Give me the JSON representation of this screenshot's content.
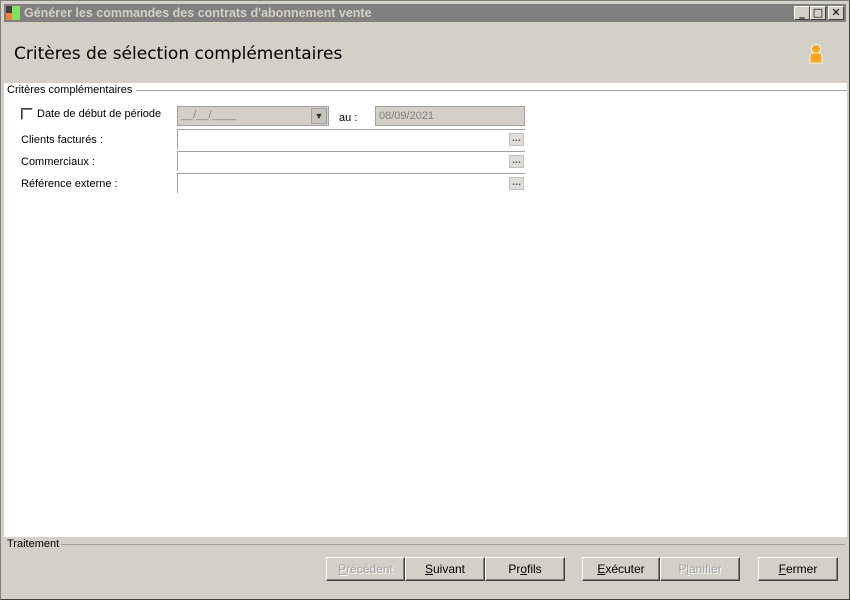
{
  "window": {
    "title": "Générer les commandes des contrats d'abonnement vente",
    "minimize": "_",
    "maximize": "□",
    "close": "✕"
  },
  "header": {
    "title": "Critères de sélection complémentaires",
    "icon": "user-icon"
  },
  "group": {
    "legend": "Critères complémentaires"
  },
  "form": {
    "date_label": "Date de début de période",
    "date_from": "__/__/____",
    "au_label": "au :",
    "date_to": "08/09/2021",
    "clients_label": "Clients facturés :",
    "commerciaux_label": "Commerciaux :",
    "reference_label": "Référence externe :",
    "ellipsis": "..."
  },
  "footer": {
    "legend": "Traitement"
  },
  "buttons": {
    "precedent": {
      "pre": "",
      "key": "P",
      "post": "récédent"
    },
    "suivant": {
      "pre": "",
      "key": "S",
      "post": "uivant"
    },
    "profils": {
      "pre": "Pr",
      "key": "o",
      "post": "fils"
    },
    "executer": {
      "pre": "",
      "key": "E",
      "post": "xécuter"
    },
    "planifier": {
      "pre": "P",
      "key": "l",
      "post": "anifier"
    },
    "fermer": {
      "pre": "",
      "key": "F",
      "post": "ermer"
    }
  }
}
